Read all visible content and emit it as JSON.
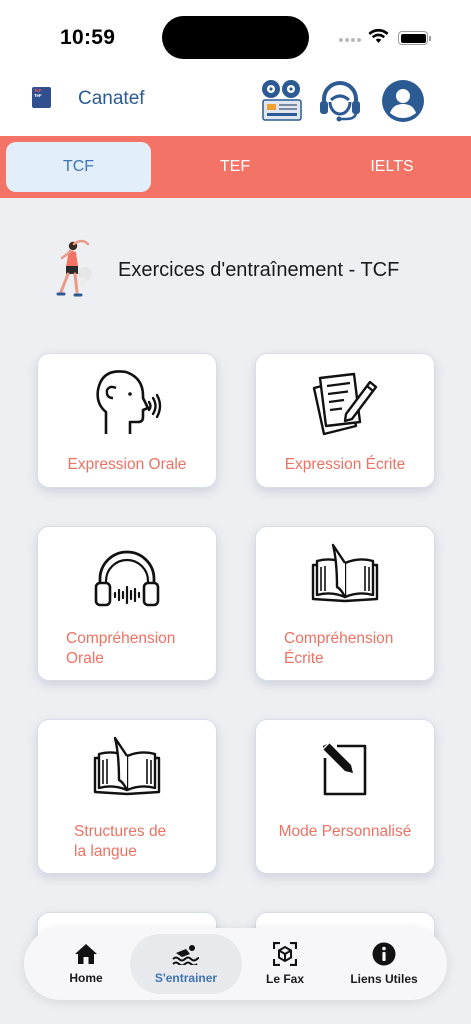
{
  "status_bar": {
    "time": "10:59"
  },
  "header": {
    "logo_top": "TcF",
    "logo_bottom": "TeF",
    "app_name": "Canatef"
  },
  "tabs": [
    {
      "label": "TCF",
      "active": true
    },
    {
      "label": "TEF",
      "active": false
    },
    {
      "label": "IELTS",
      "active": false
    }
  ],
  "section": {
    "title": "Exercices d'entraînement - TCF"
  },
  "cards": [
    {
      "label": "Expression Orale",
      "icon": "speaking-head-icon"
    },
    {
      "label": "Expression Écrite",
      "icon": "writing-paper-icon"
    },
    {
      "label_line1": "Compréhension",
      "label_line2": "Orale",
      "icon": "headphones-icon"
    },
    {
      "label_line1": "Compréhension",
      "label_line2": "Écrite",
      "icon": "open-book-icon"
    },
    {
      "label_line1": "Structures de",
      "label_line2": "la langue",
      "icon": "open-book-icon"
    },
    {
      "label": "Mode Personnalisé",
      "icon": "edit-note-icon"
    }
  ],
  "bottom_nav": [
    {
      "label": "Home",
      "icon": "home-icon",
      "active": false
    },
    {
      "label": "S'entrainer",
      "icon": "swimmer-icon",
      "active": true
    },
    {
      "label": "Le Fax",
      "icon": "cube-scan-icon",
      "active": false
    },
    {
      "label": "Liens Utiles",
      "icon": "info-icon",
      "active": false
    }
  ],
  "colors": {
    "accent": "#f37466",
    "label": "#ee7264",
    "brand_blue": "#2c5b93",
    "active_tab_bg": "#e3eefb"
  }
}
